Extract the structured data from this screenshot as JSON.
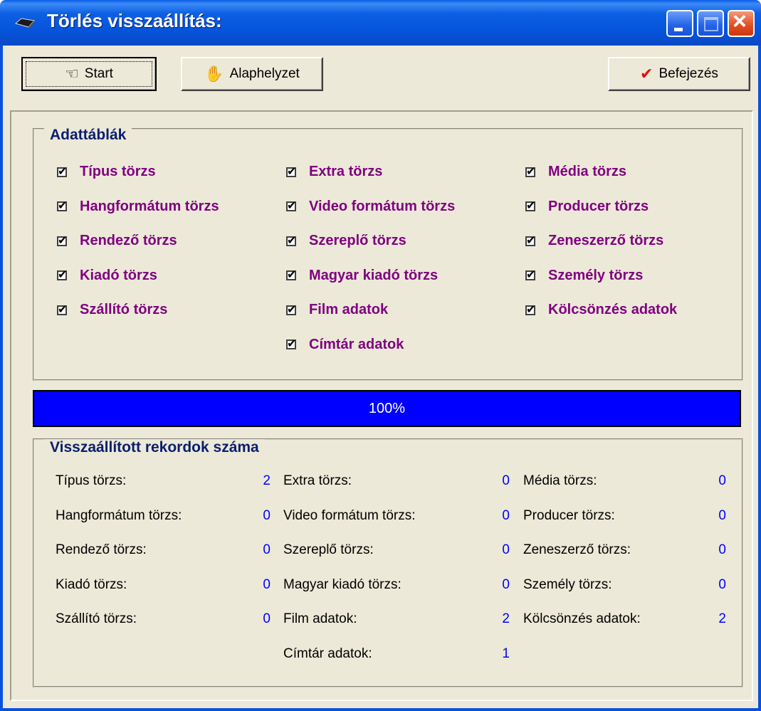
{
  "window": {
    "title": "Törlés visszaállítás:",
    "icon": "tape-icon"
  },
  "toolbar": {
    "start_label": "Start",
    "reset_label": "Alaphelyzet",
    "finish_label": "Befejezés"
  },
  "tables_group": {
    "title": "Adattáblák",
    "columns": [
      [
        {
          "label": "Típus törzs",
          "checked": true
        },
        {
          "label": "Hangformátum törzs",
          "checked": true
        },
        {
          "label": "Rendező törzs",
          "checked": true
        },
        {
          "label": "Kiadó törzs",
          "checked": true
        },
        {
          "label": "Szállító törzs",
          "checked": true
        }
      ],
      [
        {
          "label": "Extra törzs",
          "checked": true
        },
        {
          "label": "Video formátum törzs",
          "checked": true
        },
        {
          "label": "Szereplő törzs",
          "checked": true
        },
        {
          "label": "Magyar kiadó törzs",
          "checked": true
        },
        {
          "label": "Film adatok",
          "checked": true
        },
        {
          "label": "Címtár adatok",
          "checked": true
        }
      ],
      [
        {
          "label": "Média törzs",
          "checked": true
        },
        {
          "label": "Producer törzs",
          "checked": true
        },
        {
          "label": "Zeneszerző törzs",
          "checked": true
        },
        {
          "label": "Személy törzs",
          "checked": true
        },
        {
          "label": "Kölcsönzés adatok",
          "checked": true
        }
      ]
    ]
  },
  "progress": {
    "value": 100,
    "label": "100%"
  },
  "counts_group": {
    "title": "Visszaállított rekordok száma",
    "columns": [
      [
        {
          "label": "Típus törzs:",
          "value": "2"
        },
        {
          "label": "Hangformátum törzs:",
          "value": "0"
        },
        {
          "label": "Rendező törzs:",
          "value": "0"
        },
        {
          "label": "Kiadó törzs:",
          "value": "0"
        },
        {
          "label": "Szállító törzs:",
          "value": "0"
        }
      ],
      [
        {
          "label": "Extra törzs:",
          "value": "0"
        },
        {
          "label": "Video formátum törzs:",
          "value": "0"
        },
        {
          "label": "Szereplő törzs:",
          "value": "0"
        },
        {
          "label": "Magyar kiadó törzs:",
          "value": "0"
        },
        {
          "label": "Film adatok:",
          "value": "2"
        },
        {
          "label": "Címtár adatok:",
          "value": "1"
        }
      ],
      [
        {
          "label": "Média törzs:",
          "value": "0"
        },
        {
          "label": "Producer törzs:",
          "value": "0"
        },
        {
          "label": "Zeneszerző törzs:",
          "value": "0"
        },
        {
          "label": "Személy törzs:",
          "value": "0"
        },
        {
          "label": "Kölcsönzés adatok:",
          "value": "2"
        }
      ]
    ]
  },
  "colors": {
    "titlebar": "#0553da",
    "checkbox_label": "#800080",
    "group_title": "#0a1e6e",
    "count_value": "#0000ff",
    "progress_fill": "#0000ff"
  }
}
